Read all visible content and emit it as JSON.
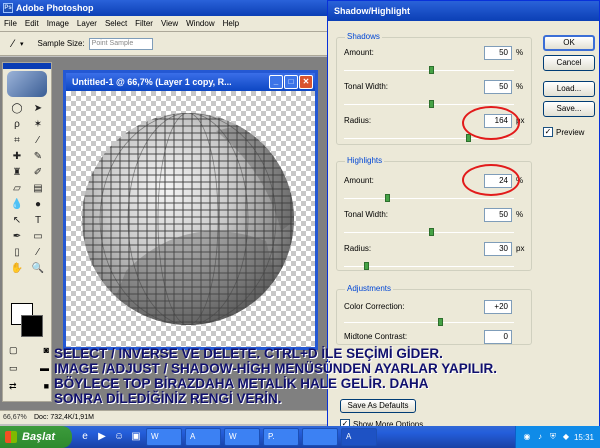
{
  "app": {
    "title": "Adobe Photoshop",
    "menu": [
      "File",
      "Edit",
      "Image",
      "Layer",
      "Select",
      "Filter",
      "View",
      "Window",
      "Help"
    ],
    "options_bar": {
      "sample_size_label": "Sample Size:",
      "sample_size_value": "Point Sample"
    }
  },
  "document": {
    "title": "Untitled-1 @ 66,7% (Layer 1 copy, R...",
    "status_zoom": "66,67%",
    "status_doc": "Doc: 732,4K/1,91M"
  },
  "dialog": {
    "title": "Shadow/Highlight",
    "shadows": {
      "group_label": "Shadows",
      "amount": {
        "label": "Amount:",
        "value": "50",
        "unit": "%",
        "slider": 0.5
      },
      "tonal_width": {
        "label": "Tonal Width:",
        "value": "50",
        "unit": "%",
        "slider": 0.5
      },
      "radius": {
        "label": "Radius:",
        "value": "164",
        "unit": "px",
        "slider": 0.72
      }
    },
    "highlights": {
      "group_label": "Highlights",
      "amount": {
        "label": "Amount:",
        "value": "24",
        "unit": "%",
        "slider": 0.24
      },
      "tonal_width": {
        "label": "Tonal Width:",
        "value": "50",
        "unit": "%",
        "slider": 0.5
      },
      "radius": {
        "label": "Radius:",
        "value": "30",
        "unit": "px",
        "slider": 0.12
      }
    },
    "adjustments": {
      "group_label": "Adjustments",
      "color_correction": {
        "label": "Color Correction:",
        "value": "+20",
        "slider": 0.55
      },
      "midtone_contrast": {
        "label": "Midtone Contrast:",
        "value": "0"
      }
    },
    "buttons": {
      "ok": "OK",
      "cancel": "Cancel",
      "load": "Load...",
      "save": "Save...",
      "save_as_defaults": "Save As Defaults"
    },
    "preview": {
      "label": "Preview",
      "checked": true
    },
    "show_more_options": {
      "label": "Show More Options",
      "checked": true
    }
  },
  "caption": [
    "SELECT / INVERSE VE DELETE. CTRL+D İLE SEÇİMİ GİDER.",
    "IMAGE /ADJUST / SHADOW-HİGH MENÜSÜNDEN AYARLAR YAPILIR.",
    "BÖYLECE TOP BİRAZDAHA METALİK HALE GELİR. DAHA",
    "SONRA DİLEDİĞİNİZ RENGİ VERİN."
  ],
  "taskbar": {
    "start_label": "Başlat",
    "items": [
      "W",
      "A",
      "W",
      "P.",
      "",
      "A"
    ],
    "active_index": 5,
    "clock": "15:31"
  },
  "colors": {
    "highlight_circle": "#e21b1b",
    "caption_text": "#10106e",
    "xp_blue": "#0b3fb5"
  }
}
